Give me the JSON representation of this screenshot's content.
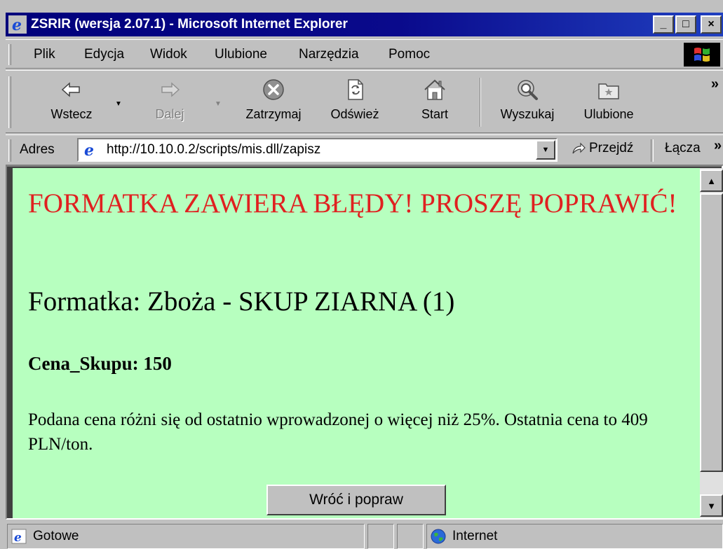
{
  "window": {
    "title": "ZSRIR (wersja 2.07.1) - Microsoft Internet Explorer",
    "buttons": {
      "minimize": "_",
      "maximize": "□",
      "close": "×"
    }
  },
  "menu": [
    {
      "label": "Plik"
    },
    {
      "label": "Edycja"
    },
    {
      "label": "Widok"
    },
    {
      "label": "Ulubione"
    },
    {
      "label": "Narzędzia"
    },
    {
      "label": "Pomoc"
    }
  ],
  "toolbar": {
    "back": "Wstecz",
    "forward": "Dalej",
    "stop": "Zatrzymaj",
    "refresh": "Odśwież",
    "home": "Start",
    "search": "Wyszukaj",
    "favorites": "Ulubione",
    "more": "»"
  },
  "address_bar": {
    "label": "Adres",
    "url": "http://10.10.0.2/scripts/mis.dll/zapisz",
    "go": "Przejdź",
    "links": "Łącza",
    "links_more": "»"
  },
  "page": {
    "error_heading": "FORMATKA ZAWIERA BŁĘDY! PROSZĘ POPRAWIĆ!",
    "form_title": "Formatka: Zboża - SKUP ZIARNA (1)",
    "field_line": "Cena_Skupu: 150",
    "message": "Podana cena różni się od ostatnio wprowadzonej o więcej niż 25%. Ostatnia cena to 409 PLN/ton.",
    "back_button": "Wróć i popraw"
  },
  "status_bar": {
    "status": "Gotowe",
    "zone": "Internet"
  },
  "colors": {
    "titlebar": "#00007b",
    "page_background": "#b7ffbf",
    "error_text": "#e02020",
    "chrome": "#c0c0c0"
  },
  "icons": [
    "ie-icon",
    "back-arrow-icon",
    "forward-arrow-icon",
    "stop-icon",
    "refresh-icon",
    "home-icon",
    "search-icon",
    "favorites-icon",
    "go-arrow-icon",
    "globe-icon",
    "windows-logo-icon"
  ]
}
